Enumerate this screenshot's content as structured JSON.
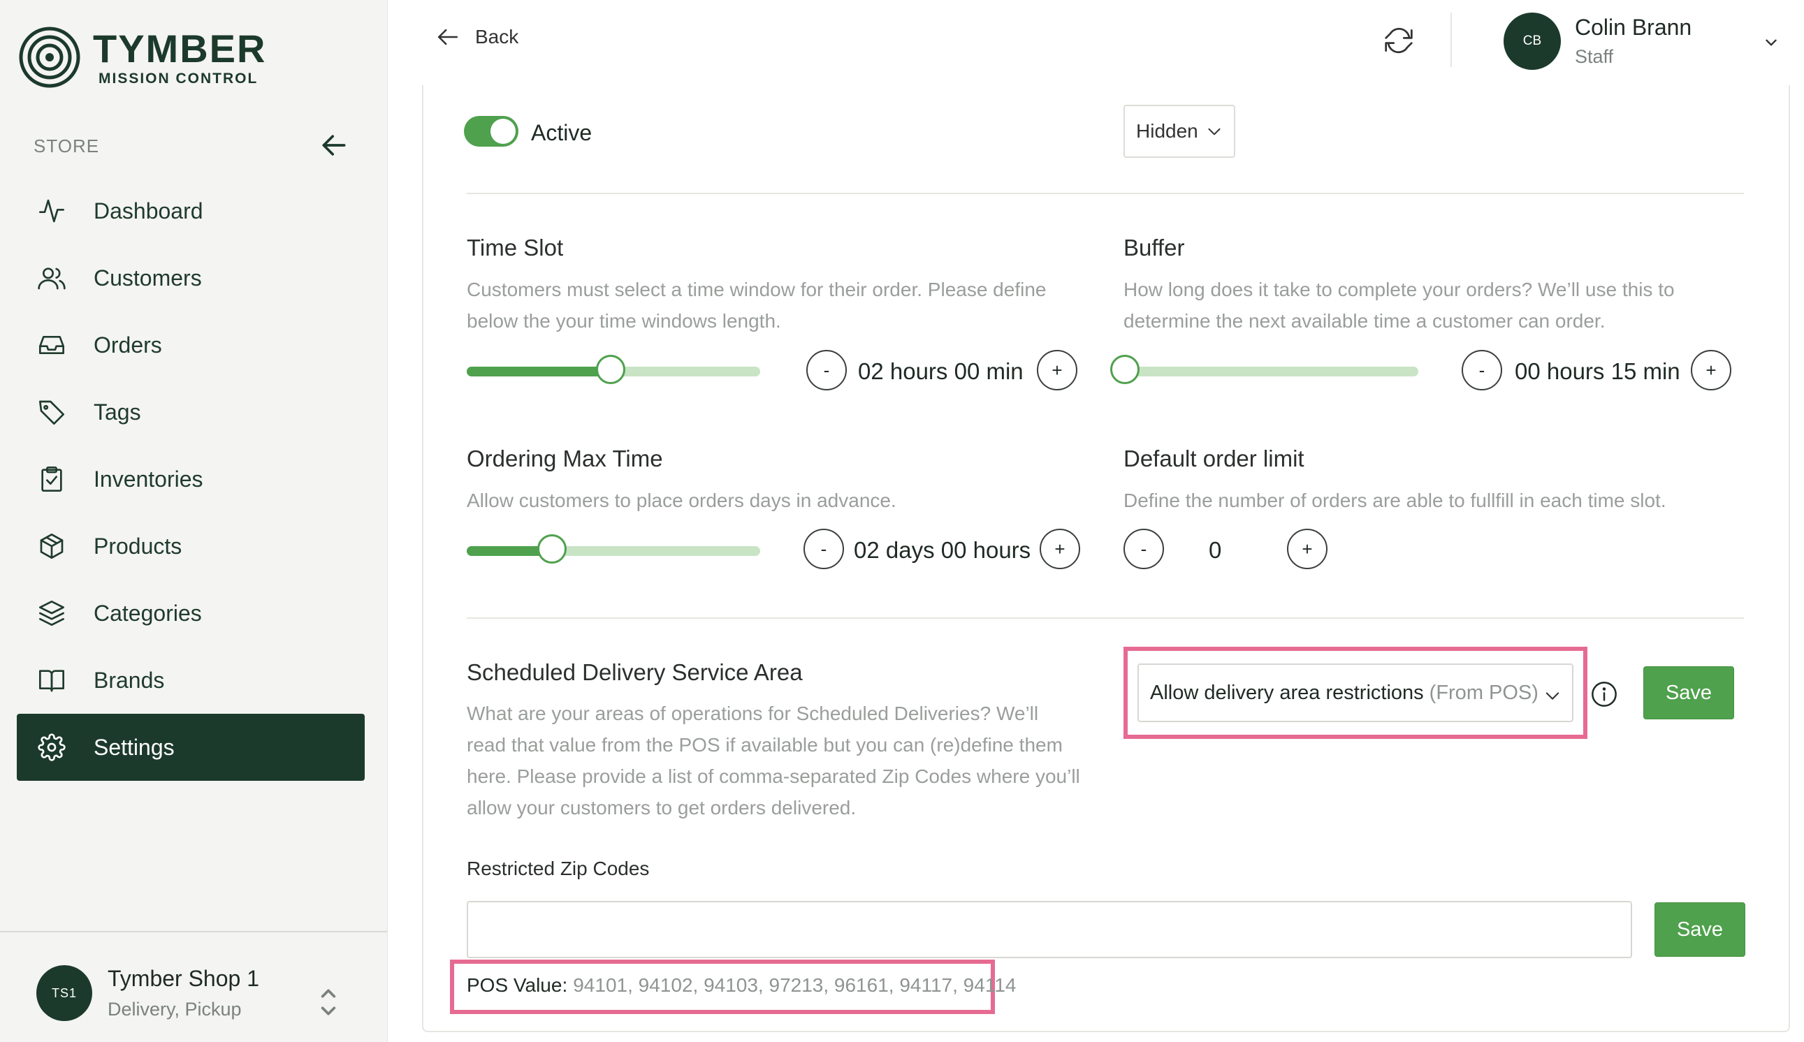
{
  "brand": {
    "name": "TYMBER",
    "subtitle": "MISSION CONTROL"
  },
  "sidebar": {
    "section_label": "STORE",
    "items": [
      {
        "label": "Dashboard",
        "icon": "activity-icon"
      },
      {
        "label": "Customers",
        "icon": "users-icon"
      },
      {
        "label": "Orders",
        "icon": "inbox-icon"
      },
      {
        "label": "Tags",
        "icon": "tag-icon"
      },
      {
        "label": "Inventories",
        "icon": "clipboard-check-icon"
      },
      {
        "label": "Products",
        "icon": "box-icon"
      },
      {
        "label": "Categories",
        "icon": "layers-icon"
      },
      {
        "label": "Brands",
        "icon": "book-open-icon"
      },
      {
        "label": "Settings",
        "icon": "gear-icon",
        "active": true
      }
    ],
    "shop": {
      "initials": "TS1",
      "name": "Tymber Shop 1",
      "subtitle": "Delivery, Pickup"
    }
  },
  "header": {
    "back_label": "Back",
    "user": {
      "initials": "CB",
      "name": "Colin Brann",
      "role": "Staff"
    }
  },
  "settings": {
    "active": {
      "label": "Active",
      "on": true
    },
    "visibility_select": "Hidden",
    "time_slot": {
      "title": "Time Slot",
      "description": "Customers must select a time window for their order. Please define below the your time windows length.",
      "value": "02 hours 00 min",
      "slider_fraction": 0.49
    },
    "buffer": {
      "title": "Buffer",
      "description": "How long does it take to complete your orders? We’ll use this to determine the next available time a customer can order.",
      "value": "00 hours 15 min",
      "slider_fraction": 0.0
    },
    "ordering_max_time": {
      "title": "Ordering Max Time",
      "description": "Allow customers to place orders days in advance.",
      "value": "02 days 00 hours",
      "slider_fraction": 0.29
    },
    "default_order_limit": {
      "title": "Default order limit",
      "description": "Define the number of orders are able to fullfill in each time slot.",
      "value": "0"
    },
    "delivery_area": {
      "title": "Scheduled Delivery Service Area",
      "description": "What are your areas of operations for Scheduled Deliveries? We’ll read that value from the POS if available but you can (re)define them here. Please provide a list of comma-separated Zip Codes where you’ll allow your customers to get orders delivered.",
      "select_label": "Allow delivery area restrictions",
      "select_sub": "(From POS)",
      "save_label": "Save"
    },
    "restricted_zip": {
      "label": "Restricted Zip Codes",
      "value": "",
      "save_label": "Save",
      "pos_label": "POS Value:",
      "pos_value": "94101, 94102, 94103, 97213, 96161, 94117, 94114"
    },
    "stepper": {
      "minus": "-",
      "plus": "+"
    }
  },
  "colors": {
    "brand_dark": "#1c3a2b",
    "accent_green": "#4fa14d",
    "slider_track": "#c8e4c4",
    "highlight_pink": "#e66b93"
  }
}
